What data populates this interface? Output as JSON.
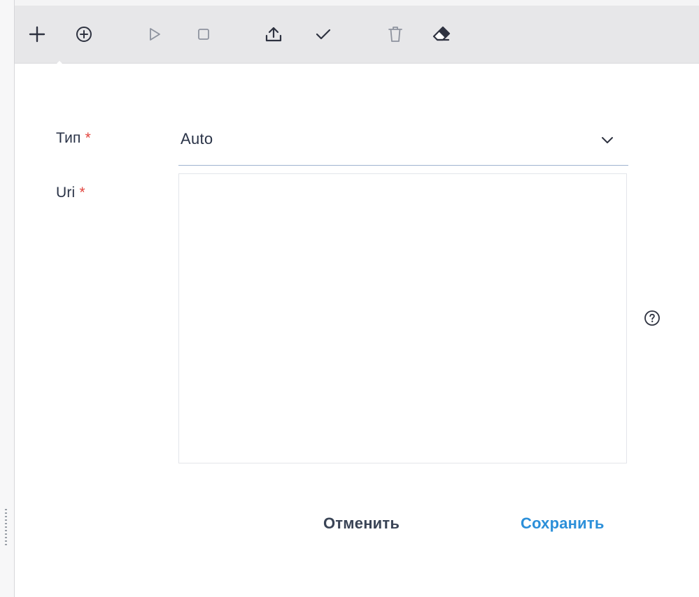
{
  "toolbar": {
    "items": [
      {
        "icon": "plus-icon"
      },
      {
        "icon": "circle-plus-icon"
      },
      {
        "icon": "play-icon"
      },
      {
        "icon": "stop-icon"
      },
      {
        "icon": "upload-icon"
      },
      {
        "icon": "check-icon"
      },
      {
        "icon": "trash-icon"
      },
      {
        "icon": "eraser-icon"
      }
    ]
  },
  "form": {
    "type_label": "Тип",
    "type_value": "Auto",
    "uri_label": "Uri",
    "uri_value": "",
    "required_mark": "*"
  },
  "actions": {
    "cancel_label": "Отменить",
    "save_label": "Сохранить"
  },
  "colors": {
    "accent": "#2b8fd9",
    "required": "#e2453f",
    "text": "#2a3347",
    "toolbar_bg": "#e7e7e9"
  }
}
